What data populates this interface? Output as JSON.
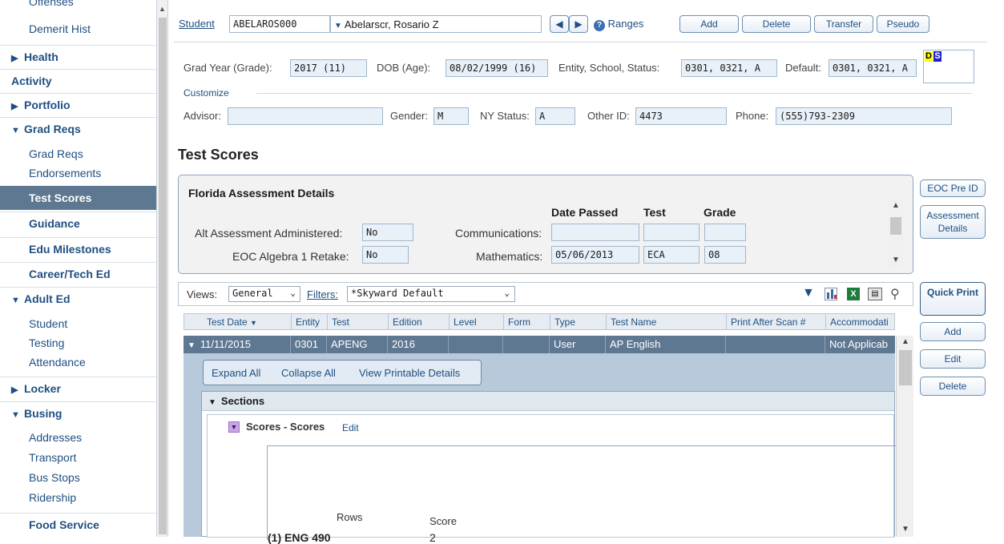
{
  "sidebar": {
    "items": [
      {
        "label": "Offenses",
        "kind": "sub"
      },
      {
        "label": "Demerit Hist",
        "kind": "sub"
      },
      {
        "label": "Health",
        "kind": "cat",
        "expanded": false
      },
      {
        "label": "Activity",
        "kind": "cat-plain"
      },
      {
        "label": "Portfolio",
        "kind": "cat",
        "expanded": false
      },
      {
        "label": "Grad Reqs",
        "kind": "cat",
        "expanded": true
      },
      {
        "label": "Grad Reqs",
        "kind": "sub"
      },
      {
        "label": "Endorsements",
        "kind": "sub"
      },
      {
        "label": "Test Scores",
        "kind": "active"
      },
      {
        "label": "Guidance",
        "kind": "cat-plain"
      },
      {
        "label": "Edu Milestones",
        "kind": "cat-plain"
      },
      {
        "label": "Career/Tech Ed",
        "kind": "cat-plain"
      },
      {
        "label": "Adult Ed",
        "kind": "cat",
        "expanded": true
      },
      {
        "label": "Student",
        "kind": "sub"
      },
      {
        "label": "Testing",
        "kind": "sub"
      },
      {
        "label": "Attendance",
        "kind": "sub"
      },
      {
        "label": "Locker",
        "kind": "cat",
        "expanded": false
      },
      {
        "label": "Busing",
        "kind": "cat",
        "expanded": true
      },
      {
        "label": "Addresses",
        "kind": "sub"
      },
      {
        "label": "Transport",
        "kind": "sub"
      },
      {
        "label": "Bus Stops",
        "kind": "sub"
      },
      {
        "label": "Ridership",
        "kind": "sub"
      },
      {
        "label": "Food Service",
        "kind": "cat-plain"
      }
    ]
  },
  "student_bar": {
    "label": "Student",
    "id": "ABELAROS000",
    "name": "Abelarscr, Rosario Z",
    "prev_icon": "triangle-left-icon",
    "next_icon": "triangle-right-icon",
    "ranges_label": "Ranges",
    "add_label": "Add",
    "delete_label": "Delete",
    "transfer_label": "Transfer",
    "pseudo_label": "Pseudo"
  },
  "student_info": {
    "grad_year_label": "Grad Year (Grade):",
    "grad_year": "2017 (11)",
    "dob_label": "DOB (Age):",
    "dob": "08/02/1999 (16)",
    "entity_label": "Entity, School, Status:",
    "entity": "0301, 0321, A",
    "default_label": "Default:",
    "default": "0301, 0321, A",
    "customize_label": "Customize",
    "advisor_label": "Advisor:",
    "advisor": "",
    "gender_label": "Gender:",
    "gender": "M",
    "ny_status_label": "NY Status:",
    "ny_status": "A",
    "other_id_label": "Other ID:",
    "other_id": "4473",
    "phone_label": "Phone:",
    "phone": "(555)793-2309",
    "flag_d": "D",
    "flag_s": "S"
  },
  "page_title": "Test Scores",
  "assessment": {
    "title": "Florida Assessment Details",
    "col_date": "Date Passed",
    "col_test": "Test",
    "col_grade": "Grade",
    "alt_label": "Alt Assessment Administered:",
    "alt_value": "No",
    "eoc_label": "EOC Algebra 1 Retake:",
    "eoc_value": "No",
    "comm_label": "Communications:",
    "comm_date": "",
    "comm_test": "",
    "comm_grade": "",
    "math_label": "Mathematics:",
    "math_date": "05/06/2013",
    "math_test": "ECA",
    "math_grade": "08"
  },
  "right_buttons": {
    "eoc_pre_id": "EOC Pre ID",
    "assessment_details": "Assessment Details",
    "quick_print": "Quick Print",
    "add": "Add",
    "edit": "Edit",
    "delete": "Delete"
  },
  "grid_toolbar": {
    "views_label": "Views:",
    "views_value": "General",
    "filters_label": "Filters:",
    "filters_value": "*Skyward Default",
    "icons": [
      "filter-icon",
      "chart-icon",
      "excel-icon",
      "print-icon",
      "print-preview-icon"
    ]
  },
  "grid": {
    "columns": [
      "Test Date",
      "Entity",
      "Test",
      "Edition",
      "Level",
      "Form",
      "Type",
      "Test Name",
      "Print After Scan #",
      "Accommodati"
    ],
    "row": [
      "11/11/2015",
      "0301",
      "APENG",
      "2016",
      "",
      "",
      "User",
      "AP English",
      "",
      "Not Applicab"
    ]
  },
  "detail": {
    "expand_all": "Expand All",
    "collapse_all": "Collapse All",
    "view_printable": "View Printable Details",
    "sections_label": "Sections",
    "scores_label": "Scores - Scores",
    "scores_edit": "Edit",
    "rows_header": "Rows",
    "score_header": "Score",
    "score_row_label": "(1) ENG 490",
    "score_row_value": "2"
  }
}
